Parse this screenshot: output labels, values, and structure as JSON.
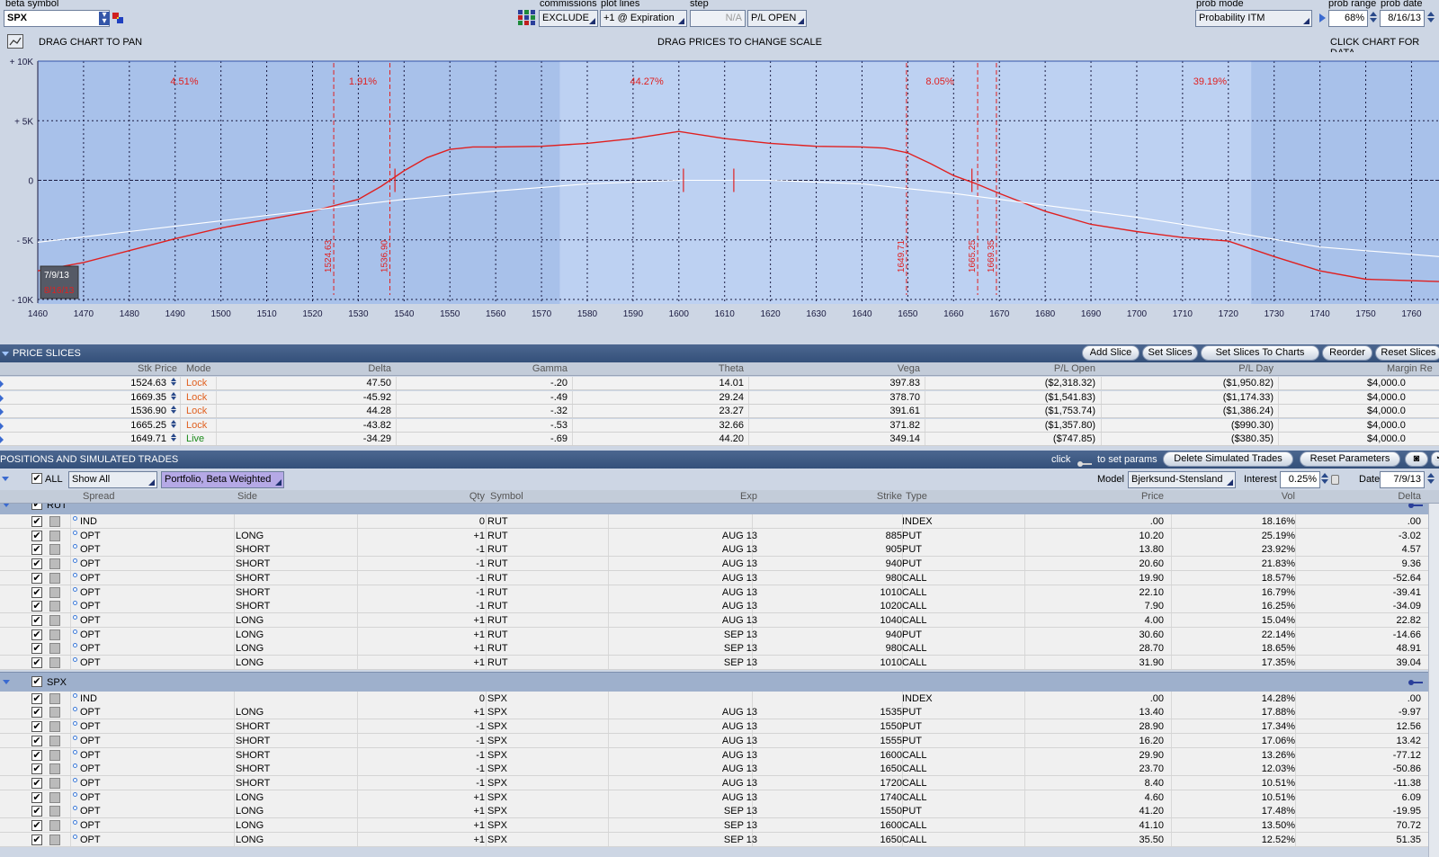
{
  "toolbar": {
    "beta_symbol_label": "beta symbol",
    "beta_symbol_value": "SPX",
    "commissions_label": "commissions",
    "commissions_value": "EXCLUDE",
    "plot_lines_label": "plot lines",
    "plot_lines_value": "+1 @ Expiration",
    "step_label": "step",
    "step_value": "N/A",
    "pl_mode_value": "P/L OPEN",
    "prob_mode_label": "prob mode",
    "prob_mode_value": "Probability ITM",
    "prob_range_label": "prob range",
    "prob_range_value": "68%",
    "prob_date_label": "prob date",
    "prob_date_value": "8/16/13"
  },
  "chart_header": {
    "drag_pan": "DRAG CHART TO PAN",
    "drag_scale": "DRAG PRICES TO CHANGE SCALE",
    "click_chart": "CLICK CHART FOR DATA"
  },
  "chart_data": {
    "type": "line",
    "x_ticks": [
      1460,
      1470,
      1480,
      1490,
      1500,
      1510,
      1520,
      1530,
      1540,
      1550,
      1560,
      1570,
      1580,
      1590,
      1600,
      1610,
      1620,
      1630,
      1640,
      1650,
      1660,
      1670,
      1680,
      1690,
      1700,
      1710,
      1720,
      1730,
      1740,
      1750,
      1760
    ],
    "y_ticks": [
      {
        "value": 10000,
        "label": "+ 10K"
      },
      {
        "value": 5000,
        "label": "+ 5K"
      },
      {
        "value": 0,
        "label": "0"
      },
      {
        "value": -5000,
        "label": "- 5K"
      },
      {
        "value": -10000,
        "label": "- 10K"
      }
    ],
    "xlim": [
      1460,
      1766
    ],
    "ylim": [
      -10000,
      10000
    ],
    "grid": true,
    "series": [
      {
        "color": "#e02020",
        "x": [
          1460,
          1470,
          1480,
          1490,
          1500,
          1510,
          1520,
          1530,
          1535,
          1540,
          1545,
          1550,
          1555,
          1560,
          1570,
          1580,
          1590,
          1600,
          1610,
          1620,
          1630,
          1640,
          1645,
          1650,
          1655,
          1660,
          1665,
          1670,
          1680,
          1690,
          1700,
          1710,
          1720,
          1730,
          1740,
          1750,
          1766
        ],
        "y": [
          -7600,
          -6900,
          -5900,
          -4900,
          -4000,
          -3300,
          -2600,
          -1600,
          -500,
          800,
          1900,
          2600,
          2800,
          2800,
          2850,
          3100,
          3500,
          4100,
          3500,
          3100,
          2850,
          2800,
          2700,
          2300,
          1400,
          400,
          -300,
          -1100,
          -2600,
          -3700,
          -4300,
          -4800,
          -5100,
          -6400,
          -7600,
          -8300,
          -8500
        ]
      },
      {
        "color": "#ffffff",
        "x": [
          1460,
          1480,
          1500,
          1520,
          1540,
          1560,
          1580,
          1600,
          1620,
          1640,
          1660,
          1680,
          1700,
          1720,
          1740,
          1766
        ],
        "y": [
          -5200,
          -4300,
          -3400,
          -2500,
          -1600,
          -900,
          -300,
          0,
          0,
          -300,
          -1100,
          -2100,
          -3100,
          -4300,
          -5600,
          -6400
        ]
      }
    ],
    "slice_lines": [
      1524.63,
      1536.9,
      1649.71,
      1665.25,
      1669.35
    ],
    "slice_labels": [
      "1524.63",
      "1536.90",
      "1649.71",
      "1665.25",
      "1669.35"
    ],
    "prob_labels": [
      {
        "x": 1492,
        "text": "4.51%"
      },
      {
        "x": 1531,
        "text": "1.91%"
      },
      {
        "x": 1593,
        "text": "44.27%"
      },
      {
        "x": 1657,
        "text": "8.05%"
      },
      {
        "x": 1716,
        "text": "39.19%"
      }
    ],
    "prob_band": [
      1574,
      1725
    ],
    "date_box": [
      "7/9/13",
      "8/16/13"
    ]
  },
  "price_slices": {
    "title": "PRICE SLICES",
    "buttons": [
      "Add Slice",
      "Set Slices",
      "Set Slices To Charts",
      "Reorder",
      "Reset Slices"
    ],
    "columns": [
      "Stk Price",
      "Mode",
      "Delta",
      "Gamma",
      "Theta",
      "Vega",
      "P/L Open",
      "P/L Day",
      "Margin Re"
    ],
    "rows": [
      [
        "1524.63",
        "Lock",
        "47.50",
        "-.20",
        "14.01",
        "397.83",
        "($2,318.32)",
        "($1,950.82)",
        "$4,000.0"
      ],
      [
        "1669.35",
        "Lock",
        "-45.92",
        "-.49",
        "29.24",
        "378.70",
        "($1,541.83)",
        "($1,174.33)",
        "$4,000.0"
      ],
      [
        "1536.90",
        "Lock",
        "44.28",
        "-.32",
        "23.27",
        "391.61",
        "($1,753.74)",
        "($1,386.24)",
        "$4,000.0"
      ],
      [
        "1665.25",
        "Lock",
        "-43.82",
        "-.53",
        "32.66",
        "371.82",
        "($1,357.80)",
        "($990.30)",
        "$4,000.0"
      ],
      [
        "1649.71",
        "Live",
        "-34.29",
        "-.69",
        "44.20",
        "349.14",
        "($747.85)",
        "($380.35)",
        "$4,000.0"
      ]
    ],
    "mode_colors": {
      "Lock": "#e06020",
      "Live": "#1a8a1a"
    }
  },
  "positions": {
    "title": "POSITIONS AND SIMULATED TRADES",
    "click_text": "click",
    "set_params_text": "to set params",
    "delete_button": "Delete Simulated Trades",
    "reset_button": "Reset Parameters",
    "all_label": "ALL",
    "show_value": "Show All",
    "portfolio_value": "Portfolio, Beta Weighted",
    "model_label": "Model",
    "model_value": "Bjerksund-Stensland",
    "interest_label": "Interest",
    "interest_value": "0.25%",
    "date_label": "Date",
    "date_value": "7/9/13",
    "columns": [
      "Spread",
      "Side",
      "Qty",
      "Symbol",
      "Exp",
      "Strike",
      "Type",
      "Price",
      "Vol",
      "Delta"
    ],
    "groups": [
      {
        "name": "RUT",
        "rows": [
          [
            "IND",
            "",
            "0",
            "RUT",
            "",
            "",
            "INDEX",
            ".00",
            "18.16%",
            ".00"
          ],
          [
            "OPT",
            "LONG",
            "+1",
            "RUT",
            "AUG 13",
            "885",
            "PUT",
            "10.20",
            "25.19%",
            "-3.02"
          ],
          [
            "OPT",
            "SHORT",
            "-1",
            "RUT",
            "AUG 13",
            "905",
            "PUT",
            "13.80",
            "23.92%",
            "4.57"
          ],
          [
            "OPT",
            "SHORT",
            "-1",
            "RUT",
            "AUG 13",
            "940",
            "PUT",
            "20.60",
            "21.83%",
            "9.36"
          ],
          [
            "OPT",
            "SHORT",
            "-1",
            "RUT",
            "AUG 13",
            "980",
            "CALL",
            "19.90",
            "18.57%",
            "-52.64"
          ],
          [
            "OPT",
            "SHORT",
            "-1",
            "RUT",
            "AUG 13",
            "1010",
            "CALL",
            "22.10",
            "16.79%",
            "-39.41"
          ],
          [
            "OPT",
            "SHORT",
            "-1",
            "RUT",
            "AUG 13",
            "1020",
            "CALL",
            "7.90",
            "16.25%",
            "-34.09"
          ],
          [
            "OPT",
            "LONG",
            "+1",
            "RUT",
            "AUG 13",
            "1040",
            "CALL",
            "4.00",
            "15.04%",
            "22.82"
          ],
          [
            "OPT",
            "LONG",
            "+1",
            "RUT",
            "SEP 13",
            "940",
            "PUT",
            "30.60",
            "22.14%",
            "-14.66"
          ],
          [
            "OPT",
            "LONG",
            "+1",
            "RUT",
            "SEP 13",
            "980",
            "CALL",
            "28.70",
            "18.65%",
            "48.91"
          ],
          [
            "OPT",
            "LONG",
            "+1",
            "RUT",
            "SEP 13",
            "1010",
            "CALL",
            "31.90",
            "17.35%",
            "39.04"
          ]
        ]
      },
      {
        "name": "SPX",
        "rows": [
          [
            "IND",
            "",
            "0",
            "SPX",
            "",
            "",
            "INDEX",
            ".00",
            "14.28%",
            ".00"
          ],
          [
            "OPT",
            "LONG",
            "+1",
            "SPX",
            "AUG 13",
            "1535",
            "PUT",
            "13.40",
            "17.88%",
            "-9.97"
          ],
          [
            "OPT",
            "SHORT",
            "-1",
            "SPX",
            "AUG 13",
            "1550",
            "PUT",
            "28.90",
            "17.34%",
            "12.56"
          ],
          [
            "OPT",
            "SHORT",
            "-1",
            "SPX",
            "AUG 13",
            "1555",
            "PUT",
            "16.20",
            "17.06%",
            "13.42"
          ],
          [
            "OPT",
            "SHORT",
            "-1",
            "SPX",
            "AUG 13",
            "1600",
            "CALL",
            "29.90",
            "13.26%",
            "-77.12"
          ],
          [
            "OPT",
            "SHORT",
            "-1",
            "SPX",
            "AUG 13",
            "1650",
            "CALL",
            "23.70",
            "12.03%",
            "-50.86"
          ],
          [
            "OPT",
            "SHORT",
            "-1",
            "SPX",
            "AUG 13",
            "1720",
            "CALL",
            "8.40",
            "10.51%",
            "-11.38"
          ],
          [
            "OPT",
            "LONG",
            "+1",
            "SPX",
            "AUG 13",
            "1740",
            "CALL",
            "4.60",
            "10.51%",
            "6.09"
          ],
          [
            "OPT",
            "LONG",
            "+1",
            "SPX",
            "SEP 13",
            "1550",
            "PUT",
            "41.20",
            "17.48%",
            "-19.95"
          ],
          [
            "OPT",
            "LONG",
            "+1",
            "SPX",
            "SEP 13",
            "1600",
            "CALL",
            "41.10",
            "13.50%",
            "70.72"
          ],
          [
            "OPT",
            "LONG",
            "+1",
            "SPX",
            "SEP 13",
            "1650",
            "CALL",
            "35.50",
            "12.52%",
            "51.35"
          ]
        ]
      }
    ]
  }
}
